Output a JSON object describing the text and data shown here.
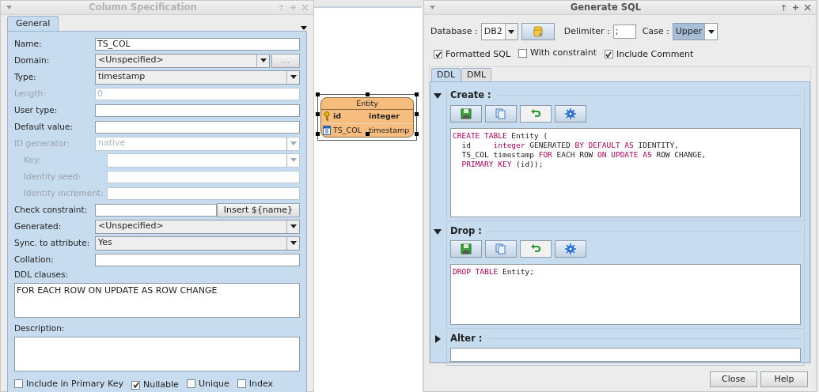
{
  "column_spec": {
    "title": "Column Specification",
    "active": false,
    "tabs": [
      {
        "label": "General",
        "selected": true
      }
    ],
    "fields": [
      {
        "kind": "text",
        "label": "Name:",
        "value": "TS_COL",
        "disabled": false
      },
      {
        "kind": "combo-browse",
        "label": "Domain:",
        "value": "<Unspecified>",
        "button": "...",
        "disabled": false
      },
      {
        "kind": "combo",
        "label": "Type:",
        "value": "timestamp",
        "disabled": false
      },
      {
        "kind": "text",
        "label": "Length:",
        "value": "0",
        "disabled": true
      },
      {
        "kind": "text",
        "label": "User type:",
        "disabled": false
      },
      {
        "kind": "text",
        "label": "Default value:",
        "disabled": false
      },
      {
        "kind": "combo",
        "label": "ID generator:",
        "value": "native",
        "disabled": true,
        "children": [
          {
            "kind": "combo",
            "label": "Key:",
            "disabled": true
          },
          {
            "kind": "text",
            "label": "Identity seed:",
            "disabled": true
          },
          {
            "kind": "text",
            "label": "Identity increment:",
            "disabled": true
          }
        ]
      },
      {
        "kind": "text-button",
        "label": "Check constraint:",
        "button": "Insert ${name}",
        "disabled": false
      },
      {
        "kind": "combo",
        "label": "Generated:",
        "value": "<Unspecified>",
        "disabled": false
      },
      {
        "kind": "combo",
        "label": "Sync. to attribute:",
        "value": "Yes",
        "disabled": false
      },
      {
        "kind": "text",
        "label": "Collation:",
        "disabled": false
      },
      {
        "kind": "area",
        "label": "DDL clauses:",
        "value": "FOR EACH ROW ON UPDATE AS ROW CHANGE"
      },
      {
        "kind": "area",
        "label": "Description:"
      }
    ],
    "checkboxes": [
      {
        "label": "Include in Primary Key",
        "checked": false
      },
      {
        "label": "Nullable",
        "checked": true
      },
      {
        "label": "Unique",
        "checked": false
      },
      {
        "label": "Index",
        "checked": false
      }
    ]
  },
  "entity": {
    "title": "Entity",
    "selected": true,
    "attributes": [
      {
        "kind": "key",
        "name": "id",
        "type": "integer"
      },
      {
        "kind": "column",
        "name": "TS_COL",
        "type": "timestamp"
      }
    ]
  },
  "generate_sql": {
    "title": "Generate SQL",
    "active": true,
    "database": {
      "label": "Database :",
      "value": "DB2"
    },
    "delimiter": {
      "label": "Delimiter :",
      "value": ";"
    },
    "case": {
      "label": "Case :",
      "value": "Upper"
    },
    "options": [
      {
        "label": "Formatted SQL",
        "checked": true
      },
      {
        "label": "With constraint",
        "checked": false
      },
      {
        "label": "Include Comment",
        "checked": true
      }
    ],
    "tabs": [
      {
        "label": "DDL",
        "selected": true
      },
      {
        "label": "DML",
        "selected": false
      }
    ],
    "sections": [
      {
        "title": "Create :",
        "expanded": true,
        "code": [
          [
            {
              "t": "CREATE TABLE",
              "kw": true
            },
            {
              "t": " Entity (",
              "kw": false
            }
          ],
          [
            {
              "t": "  id     ",
              "kw": false
            },
            {
              "t": "integer",
              "kw": true
            },
            {
              "t": " GENERATED ",
              "kw": false
            },
            {
              "t": "BY DEFAULT AS",
              "kw": true
            },
            {
              "t": " IDENTITY,",
              "kw": false
            }
          ],
          [
            {
              "t": "  TS_COL timestamp ",
              "kw": false
            },
            {
              "t": "FOR",
              "kw": true
            },
            {
              "t": " EACH ROW ",
              "kw": false
            },
            {
              "t": "ON UPDATE AS",
              "kw": true
            },
            {
              "t": " ROW CHANGE,",
              "kw": false
            }
          ],
          [
            {
              "t": "  PRIMARY KEY",
              "kw": true
            },
            {
              "t": " (id));",
              "kw": false
            }
          ]
        ]
      },
      {
        "title": "Drop :",
        "expanded": true,
        "code": [
          [
            {
              "t": "DROP TABLE",
              "kw": true
            },
            {
              "t": " Entity;",
              "kw": false
            }
          ]
        ]
      },
      {
        "title": "Alter :",
        "expanded": false
      }
    ],
    "buttons": [
      "Close",
      "Help"
    ]
  }
}
